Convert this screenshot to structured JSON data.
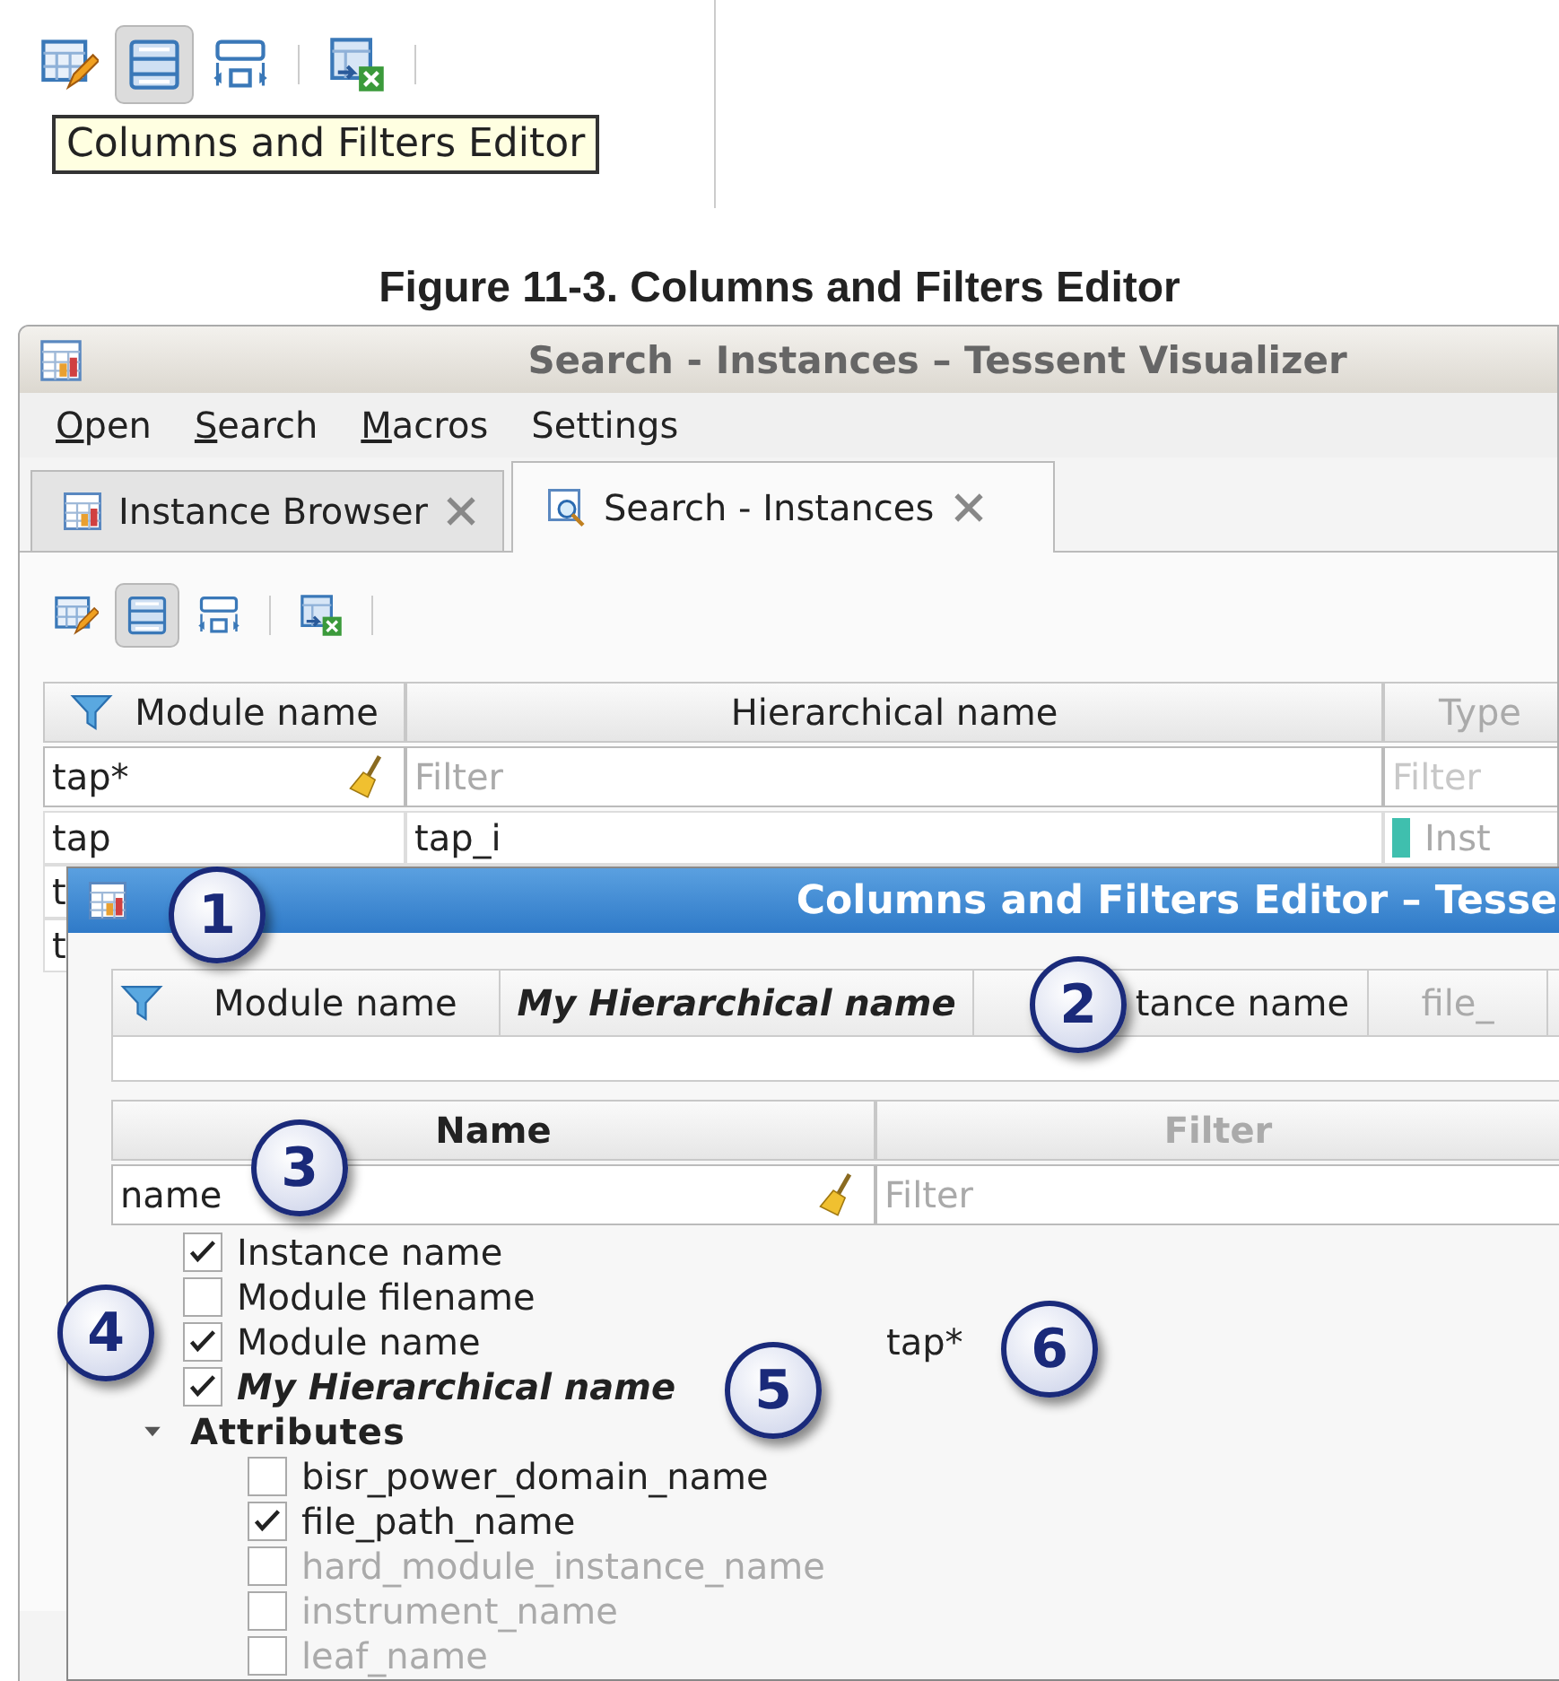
{
  "snippet": {
    "toolbar": [
      {
        "kind": "edit",
        "pressed": false
      },
      {
        "kind": "rows",
        "pressed": true
      },
      {
        "kind": "fit",
        "pressed": false
      },
      {
        "kind": "export",
        "pressed": false
      }
    ],
    "tooltip": "Columns and Filters Editor"
  },
  "caption": "Figure 11-3. Columns and Filters Editor",
  "window": {
    "title": "Search - Instances – Tessent Visualizer",
    "menu": [
      {
        "label": "Open",
        "mnemonic": true
      },
      {
        "label": "Search",
        "mnemonic": true
      },
      {
        "label": "Macros",
        "mnemonic": true
      },
      {
        "label": "Settings",
        "mnemonic": false
      }
    ],
    "tabs": [
      {
        "label": "Instance Browser",
        "kind": "browser",
        "selected": false
      },
      {
        "label": "Search - Instances",
        "kind": "search",
        "selected": true
      }
    ],
    "toolbar": [
      {
        "kind": "edit",
        "pressed": false
      },
      {
        "kind": "rows",
        "pressed": true
      },
      {
        "kind": "fit",
        "pressed": false
      },
      {
        "kind": "export",
        "pressed": false
      }
    ],
    "table": {
      "columns": [
        {
          "label": "Module name",
          "filter_value": "tap*",
          "faded": false
        },
        {
          "label": "Hierarchical name",
          "placeholder": "Filter",
          "faded": false
        },
        {
          "label": "Type",
          "placeholder": "Filter",
          "faded": true
        }
      ],
      "rows": [
        {
          "cells": [
            {
              "text": "tap"
            },
            {
              "text": "tap_i"
            },
            {
              "text": "Inst",
              "color": "#3fbfae"
            }
          ]
        },
        {
          "cells": [
            {
              "text": "t"
            }
          ]
        },
        {
          "cells": [
            {
              "text": "t"
            }
          ]
        }
      ]
    }
  },
  "dialog": {
    "title": "Columns and Filters Editor – Tesse",
    "preview_columns": [
      {
        "label": "Module name",
        "emphasis": false,
        "faded": false
      },
      {
        "label": "My Hierarchical name",
        "emphasis": true,
        "faded": false
      },
      {
        "label": "tance name",
        "emphasis": false,
        "faded": false
      },
      {
        "label": "file_",
        "emphasis": false,
        "faded": true
      }
    ],
    "headers": [
      "Name",
      "Filter"
    ],
    "name_filter": "name",
    "filter_placeholder": "Filter",
    "items": [
      {
        "label": "Instance name",
        "checked": true,
        "emphasis": false,
        "disabled": false
      },
      {
        "label": "Module filename",
        "checked": false,
        "emphasis": false,
        "disabled": false
      },
      {
        "label": "Module name",
        "checked": true,
        "emphasis": false,
        "disabled": false,
        "filter": "tap*"
      },
      {
        "label": "My Hierarchical name",
        "checked": true,
        "emphasis": true,
        "disabled": false
      },
      {
        "label": "Attributes",
        "kind": "group",
        "expanded": true,
        "children": [
          {
            "label": "bisr_power_domain_name",
            "checked": false,
            "disabled": false
          },
          {
            "label": "file_path_name",
            "checked": true,
            "disabled": false
          },
          {
            "label": "hard_module_instance_name",
            "checked": false,
            "disabled": true
          },
          {
            "label": "instrument_name",
            "checked": false,
            "disabled": true
          },
          {
            "label": "leaf_name",
            "checked": false,
            "disabled": true
          }
        ]
      }
    ]
  },
  "callouts": [
    "1",
    "2",
    "3",
    "4",
    "5",
    "6"
  ]
}
